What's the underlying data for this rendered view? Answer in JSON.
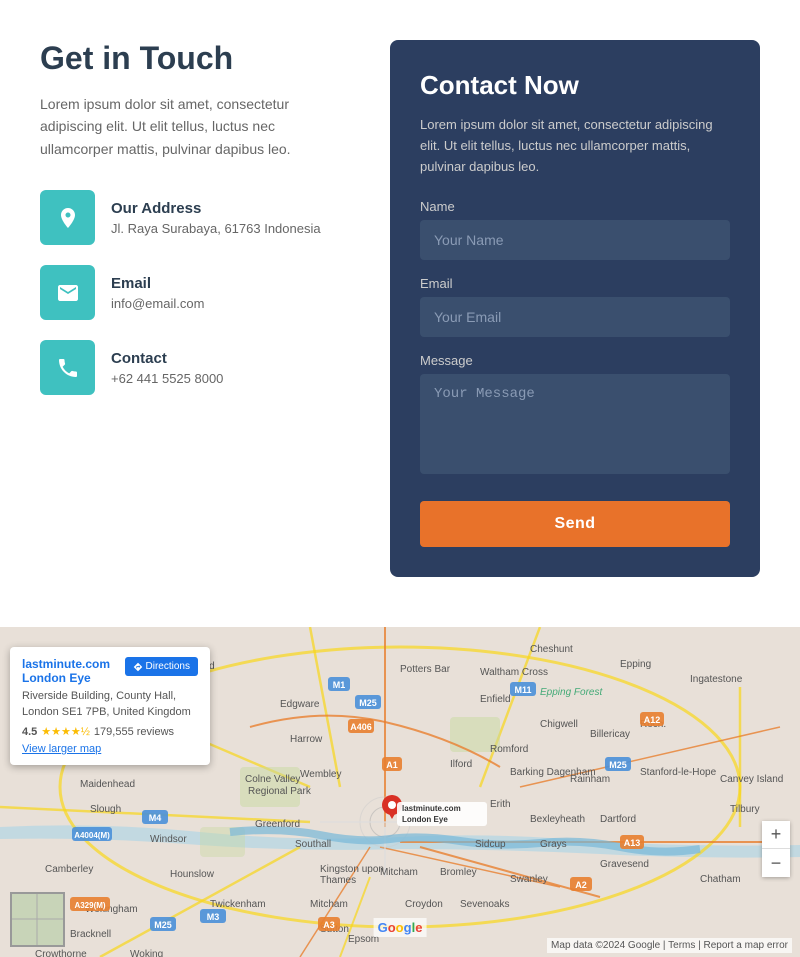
{
  "left": {
    "heading": "Get in Touch",
    "description": "Lorem ipsum dolor sit amet, consectetur adipiscing elit. Ut elit tellus, luctus nec ullamcorper mattis, pulvinar dapibus leo.",
    "address": {
      "label": "Our Address",
      "value": "Jl. Raya Surabaya, 61763 Indonesia"
    },
    "email": {
      "label": "Email",
      "value": "info@email.com"
    },
    "contact": {
      "label": "Contact",
      "value": "+62 441 5525 8000"
    }
  },
  "right": {
    "heading": "Contact Now",
    "description": "Lorem ipsum dolor sit amet, consectetur adipiscing elit. Ut elit tellus, luctus nec ullamcorper mattis, pulvinar dapibus leo.",
    "name_label": "Name",
    "name_placeholder": "Your Name",
    "email_label": "Email",
    "email_placeholder": "Your Email",
    "message_label": "Message",
    "message_placeholder": "Your Message",
    "send_label": "Send"
  },
  "map": {
    "popup_title": "lastminute.com London Eye",
    "popup_address": "Riverside Building, County Hall,\nLondon SE1 7PB, United Kingdom",
    "popup_rating": "4.5",
    "popup_reviews": "179,555 reviews",
    "popup_view_larger": "View larger map",
    "popup_directions": "Directions",
    "google_label": "Google",
    "attribution": "Map data ©2024 Google | Terms | Report a map error",
    "zoom_in": "+",
    "zoom_out": "−"
  }
}
